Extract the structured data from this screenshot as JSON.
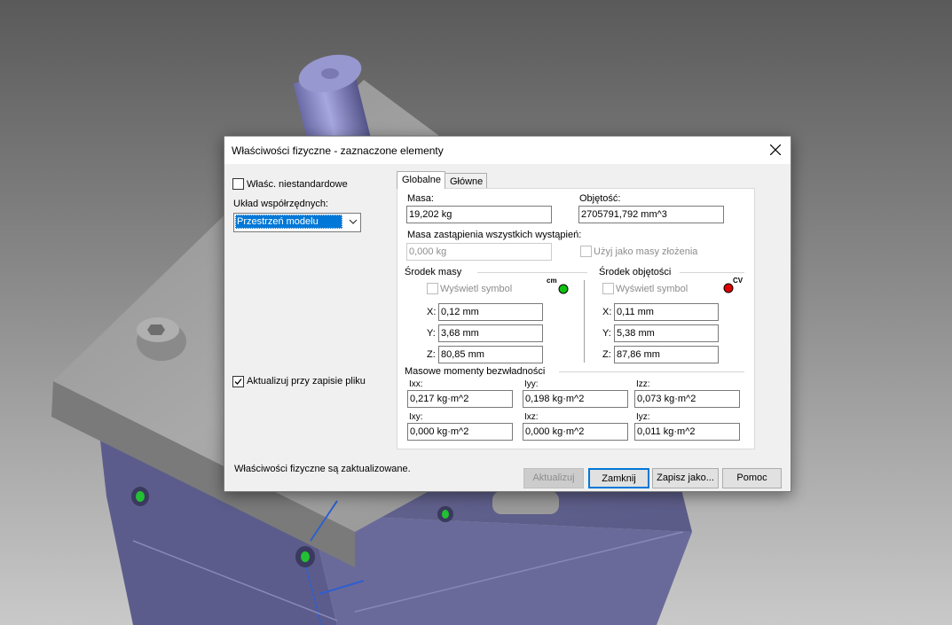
{
  "dialog": {
    "title": "Właściwości fizyczne - zaznaczone elementy",
    "close_icon": "close-icon"
  },
  "left": {
    "custom_props_label": "Właśc. niestandardowe",
    "custom_props_checked": false,
    "coord_system_label": "Układ współrzędnych:",
    "coord_system_value": "Przestrzeń modelu",
    "update_on_save_label": "Aktualizuj przy zapisie pliku",
    "update_on_save_checked": true,
    "status_text": "Właściwości fizyczne są zaktualizowane."
  },
  "tabs": [
    {
      "label": "Globalne",
      "active": true
    },
    {
      "label": "Główne",
      "active": false
    }
  ],
  "global": {
    "mass_label": "Masa:",
    "mass_value": "19,202 kg",
    "volume_label": "Objętość:",
    "volume_value": "2705791,792 mm^3",
    "override_label": "Masa zastąpienia wszystkich wystąpień:",
    "override_value": "0,000 kg",
    "use_assembly_label": "Użyj jako masy złożenia",
    "center_of_mass": {
      "title": "Środek masy",
      "show_symbol_label": "Wyświetl symbol",
      "symbol_text": "cm",
      "symbol_color": "#10c010",
      "x_label": "X:",
      "x": "0,12 mm",
      "y_label": "Y:",
      "y": "3,68 mm",
      "z_label": "Z:",
      "z": "80,85 mm"
    },
    "center_of_volume": {
      "title": "Środek objętości",
      "show_symbol_label": "Wyświetl symbol",
      "symbol_text": "CV",
      "symbol_color": "#e00000",
      "x_label": "X:",
      "x": "0,11 mm",
      "y_label": "Y:",
      "y": "5,38 mm",
      "z_label": "Z:",
      "z": "87,86 mm"
    },
    "inertia": {
      "title": "Masowe momenty bezwładności",
      "ixx_label": "Ixx:",
      "ixx": "0,217 kg·m^2",
      "iyy_label": "Iyy:",
      "iyy": "0,198 kg·m^2",
      "izz_label": "Izz:",
      "izz": "0,073 kg·m^2",
      "ixy_label": "Ixy:",
      "ixy": "0,000 kg·m^2",
      "ixz_label": "Ixz:",
      "ixz": "0,000 kg·m^2",
      "iyz_label": "Iyz:",
      "iyz": "0,011 kg·m^2"
    }
  },
  "buttons": {
    "update": "Aktualizuj",
    "close": "Zamknij",
    "save_as": "Zapisz jako...",
    "help": "Pomoc"
  },
  "colors": {
    "accent": "#0078d7",
    "part_purple": "#6e6e9e",
    "part_gray": "#9c9c9c"
  }
}
